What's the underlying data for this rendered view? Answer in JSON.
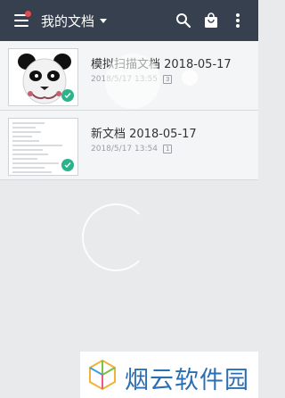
{
  "topbar": {
    "title": "我的文档",
    "background": "#36404e",
    "icons": [
      "menu-icon",
      "notification-dot",
      "dropdown-caret-icon",
      "search-icon",
      "shopping-bag-icon",
      "more-vert-icon"
    ]
  },
  "documents": [
    {
      "name": "模拟扫描文档 2018-05-17",
      "date": "2018/5/17 13:55",
      "pages": "3",
      "synced": true,
      "thumb": "panda-image"
    },
    {
      "name": "新文档 2018-05-17",
      "date": "2018/5/17 13:54",
      "pages": "1",
      "synced": true,
      "thumb": "text-document"
    }
  ],
  "watermark": {
    "text": "烟云软件园",
    "color": "#2b6fb3"
  },
  "accent": "#2bb38b"
}
